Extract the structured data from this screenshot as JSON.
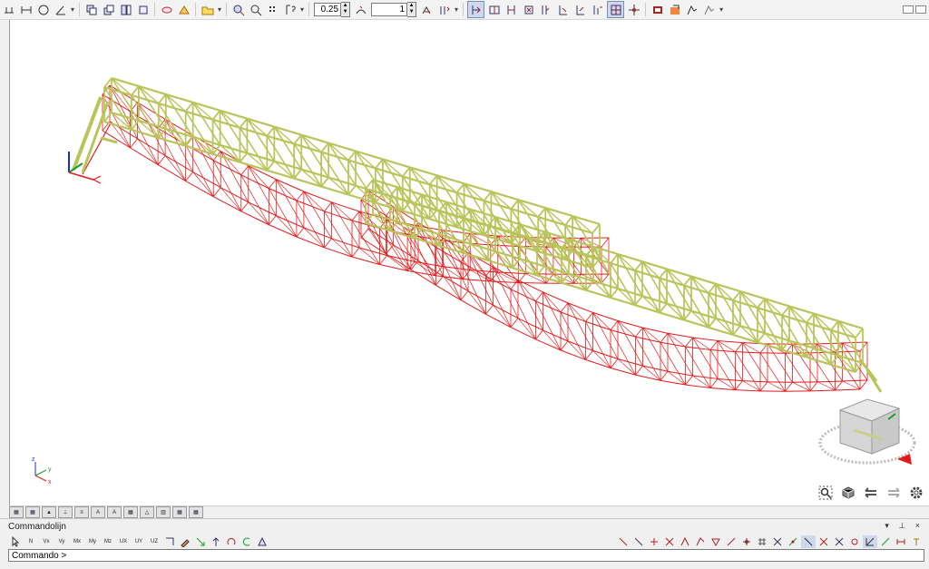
{
  "toolbar": {
    "scale_value": "0.25",
    "factor_value": "1",
    "icons": [
      "node-icon",
      "beam-icon",
      "circle-icon",
      "angle-icon",
      "copy-icon",
      "copy-array-icon",
      "mirror-icon",
      "move-icon",
      "eye-icon",
      "calculate-icon",
      "folder-icon",
      "render-icon",
      "zoom-icon",
      "grid-icon",
      "help-icon",
      "view-icon",
      "display-icon",
      "result-icon",
      "load-icon",
      "print-icon",
      "export-icon",
      "settings-icon"
    ]
  },
  "viewport": {
    "model_color_steel": "#b9c45a",
    "model_color_deformed": "#e31a1a"
  },
  "view_tools": [
    "zoom-window-icon",
    "view-cube-icon",
    "rotate-left-icon",
    "rotate-right-icon",
    "gear-icon"
  ],
  "panel": {
    "title": "Commandolijn",
    "controls": "▾ ⊥ ×",
    "command_prompt": "Commando >"
  },
  "tabs": [
    "tab-1",
    "tab-2",
    "tab-3",
    "tab-4",
    "tab-5",
    "tab-6",
    "tab-7",
    "tab-8",
    "tab-9",
    "tab-10",
    "tab-11",
    "tab-12"
  ],
  "cmd_buttons": [
    {
      "name": "select-icon",
      "label": ""
    },
    {
      "name": "cmd-n",
      "label": "N"
    },
    {
      "name": "cmd-vx",
      "label": "Vx"
    },
    {
      "name": "cmd-vy",
      "label": "Vy"
    },
    {
      "name": "cmd-mx",
      "label": "Mx"
    },
    {
      "name": "cmd-my",
      "label": "My"
    },
    {
      "name": "cmd-mz",
      "label": "Mz"
    },
    {
      "name": "cmd-ux",
      "label": "UX"
    },
    {
      "name": "cmd-uy",
      "label": "UY"
    },
    {
      "name": "cmd-uz",
      "label": "UZ"
    }
  ]
}
